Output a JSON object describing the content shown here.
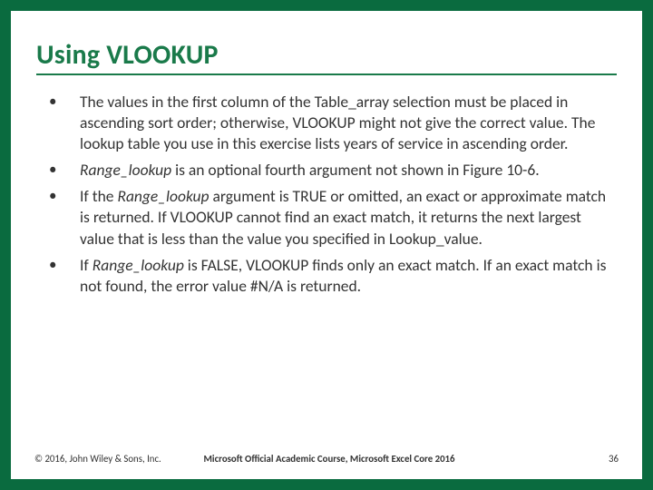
{
  "title": "Using VLOOKUP",
  "bullets": [
    {
      "text": "The values in the first column of the Table_array selection must be placed in ascending sort order; otherwise, VLOOKUP might not give the correct value. The lookup table you use in this exercise lists years of service in ascending order."
    },
    {
      "prefix_italic": "Range_lookup",
      "rest": " is an optional fourth argument not shown in Figure 10-6."
    },
    {
      "before": "If the ",
      "italic": "Range_lookup",
      "after": " argument is TRUE or omitted, an exact or approximate match is returned. If VLOOKUP cannot find an exact match, it returns the next largest value that is less than the value you specified in Lookup_value."
    },
    {
      "before": "If ",
      "italic": "Range_lookup",
      "after": " is FALSE, VLOOKUP finds only an exact match. If an exact match is not found, the error value #N/A is returned."
    }
  ],
  "footer": {
    "left": "© 2016, John Wiley & Sons, Inc.",
    "center": "Microsoft Official Academic Course, Microsoft Excel Core 2016",
    "right": "36"
  }
}
